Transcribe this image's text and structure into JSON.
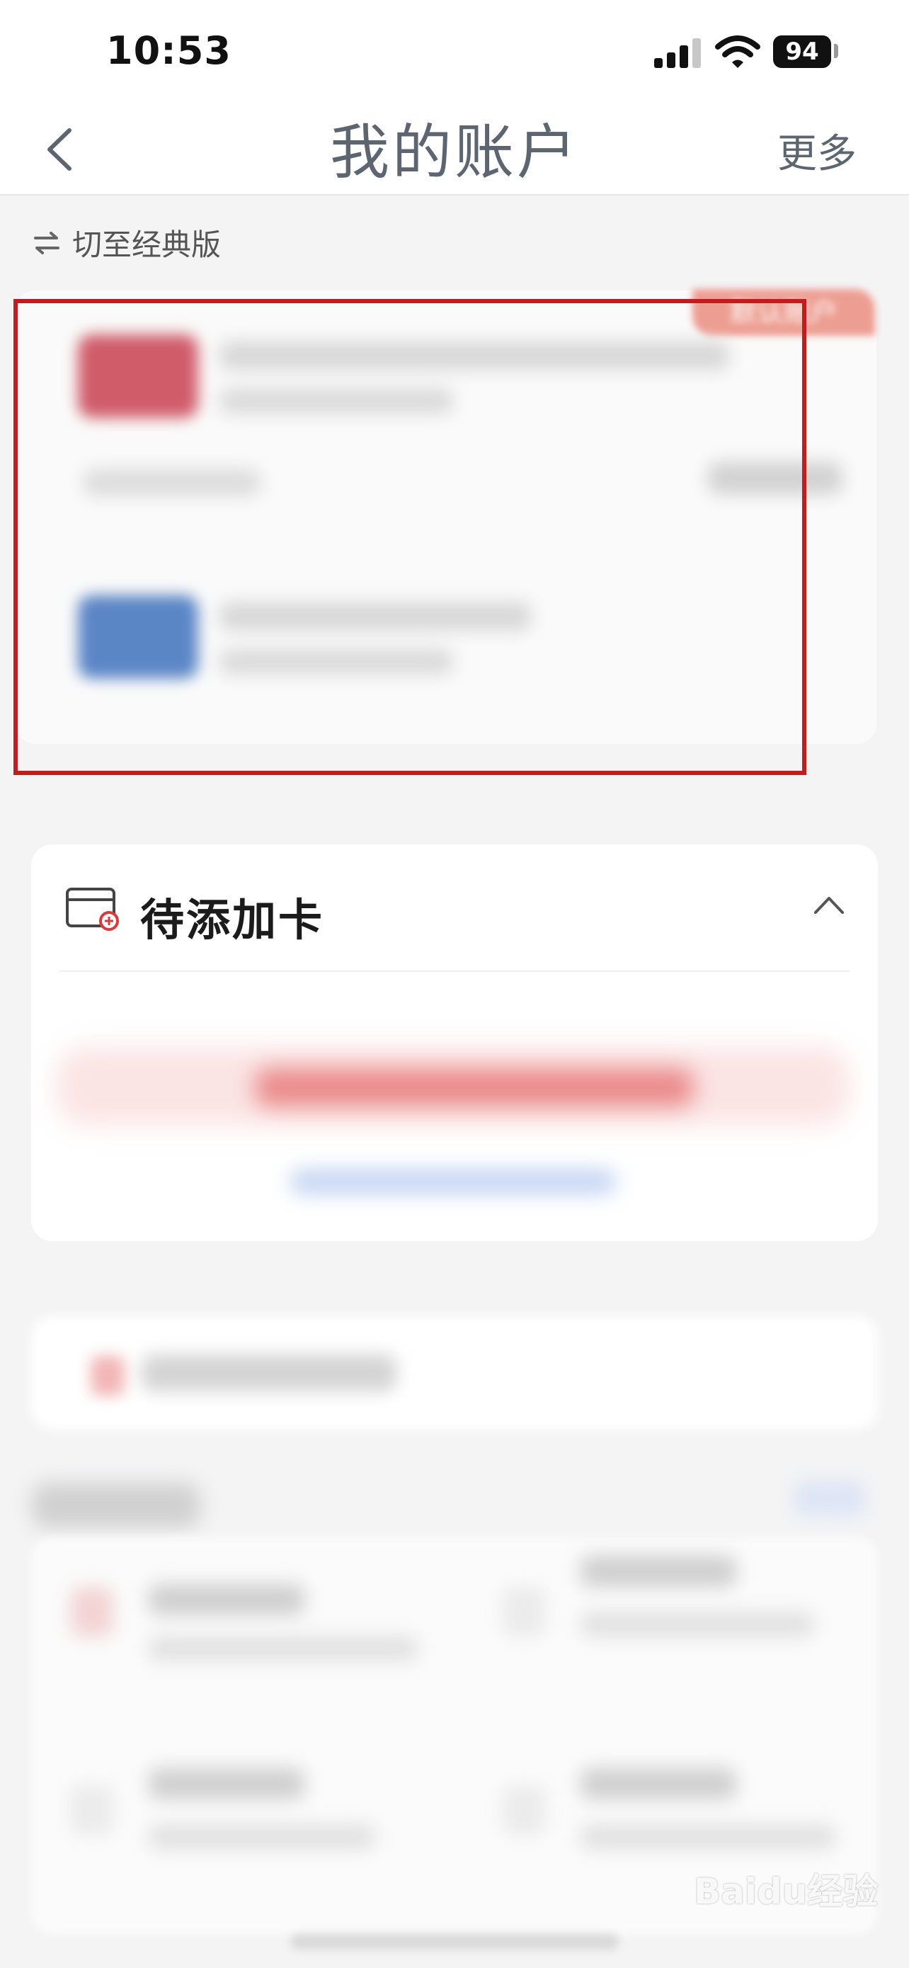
{
  "status_bar": {
    "time": "10:53",
    "battery": "94"
  },
  "nav": {
    "title": "我的账户",
    "more_label": "更多"
  },
  "switch_classic": {
    "label": "切至经典版"
  },
  "account_card": {
    "badge": "默认账户"
  },
  "pending_cards": {
    "title": "待添加卡"
  },
  "watermark": {
    "text": "Baidu经验"
  },
  "colors": {
    "highlight_border": "#c21d1d",
    "brand_red": "#e98070",
    "title_gray": "#5d6670"
  }
}
